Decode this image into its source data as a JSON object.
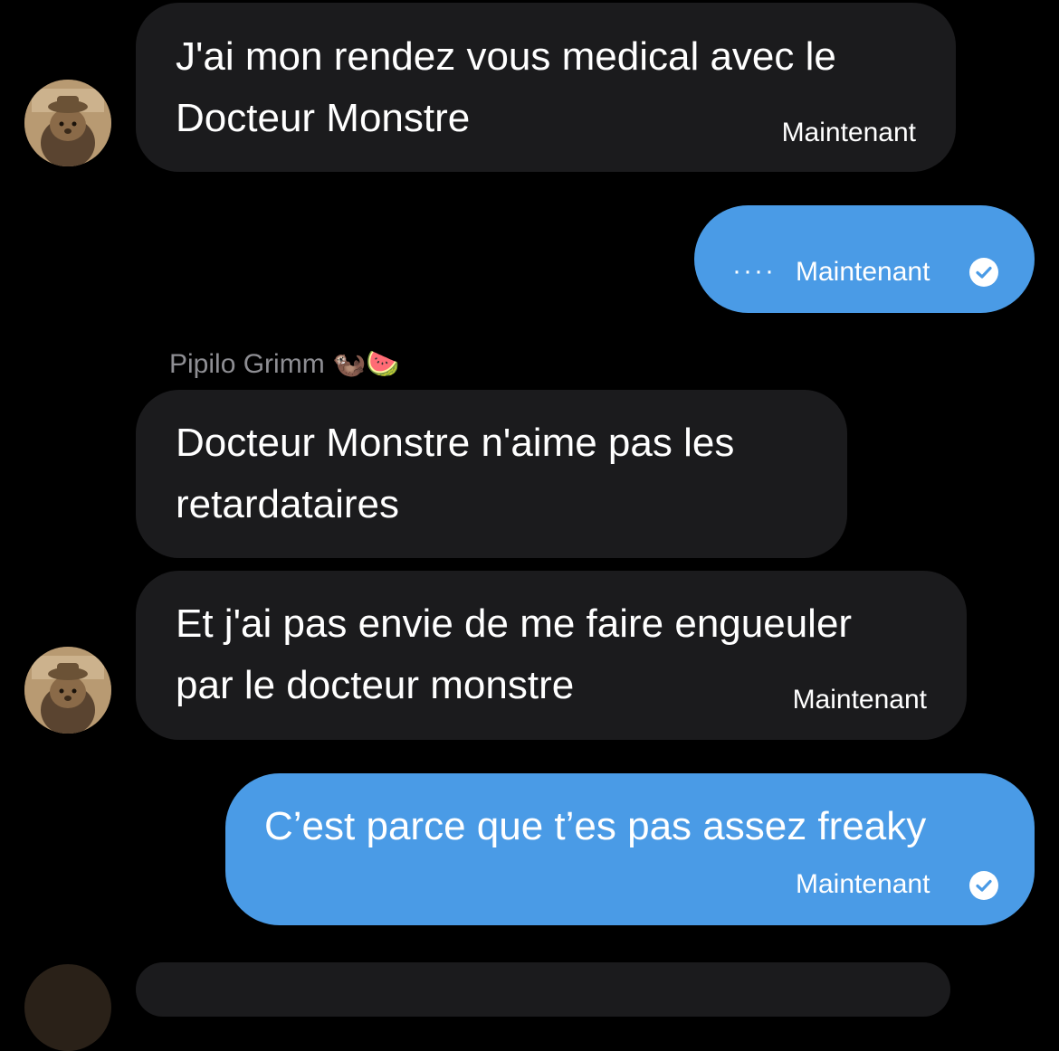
{
  "conversation": {
    "messages": [
      {
        "direction": "incoming",
        "text": "J'ai mon rendez vous medical avec le\nDocteur Monstre",
        "time": "Maintenant"
      },
      {
        "direction": "outgoing",
        "dots": "····",
        "time": "Maintenant"
      },
      {
        "direction": "incoming",
        "sender": "Pipilo Grimm 🦦🍉",
        "text": "Docteur Monstre n'aime pas les\nretardataires"
      },
      {
        "direction": "incoming",
        "text": "Et j'ai pas envie de me faire engueuler\npar le docteur monstre",
        "time": "Maintenant"
      },
      {
        "direction": "outgoing",
        "text": "C’est parce que t’es pas assez freaky",
        "time": "Maintenant"
      }
    ]
  },
  "colors": {
    "background": "#000000",
    "incoming_bubble": "#1b1b1d",
    "outgoing_bubble": "#4a9be6",
    "sender_name": "#8e8e93"
  },
  "icons": {
    "avatar": "hamster-with-hat-avatar",
    "read_receipt": "check-circle-icon"
  }
}
